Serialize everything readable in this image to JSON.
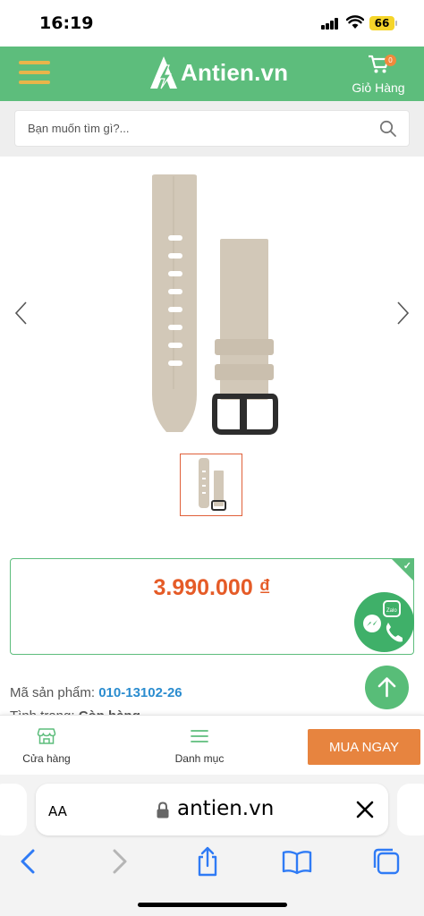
{
  "status_bar": {
    "time": "16:19",
    "battery": "66"
  },
  "header": {
    "logo_text": "Antien.vn",
    "cart_label": "Giỏ Hàng",
    "cart_count": "0",
    "brand_color": "#5dbd7c",
    "menu_icon_color": "#e9b54a"
  },
  "search": {
    "placeholder": "Bạn muốn tìm gì?..."
  },
  "product": {
    "price": "3.990.000 ₫",
    "price_color": "#e55b27",
    "sku_label": "Mã sản phẩm:",
    "sku_value": "010-13102-26",
    "status_label": "Tình trạng:",
    "status_value": "Còn hàng",
    "sku_color": "#2a8ccf"
  },
  "bottom_bar": {
    "store_label": "Cửa hàng",
    "category_label": "Danh mục",
    "buy_label": "MUA NGAY",
    "buy_color": "#e7843f"
  },
  "browser": {
    "aa_label": "AA",
    "url": "antien.vn"
  },
  "icons": {
    "menu": "hamburger-icon",
    "cart": "cart-icon",
    "search": "search-icon",
    "prev": "chevron-left-icon",
    "next": "chevron-right-icon",
    "contact": "zalo-messenger-phone-icon",
    "scroll_top": "arrow-up-icon",
    "store": "store-icon",
    "category": "list-icon",
    "lock": "lock-icon",
    "close": "close-icon",
    "back": "back-icon",
    "forward": "forward-icon",
    "share": "share-icon",
    "bookmarks": "book-icon",
    "tabs": "tabs-icon"
  }
}
